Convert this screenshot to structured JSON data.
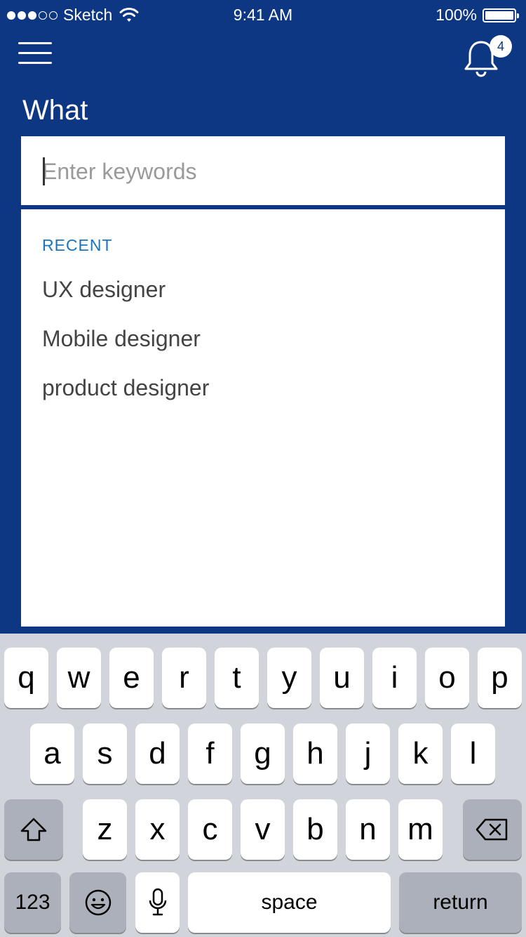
{
  "status_bar": {
    "carrier": "Sketch",
    "time": "9:41 AM",
    "battery": "100%"
  },
  "header": {
    "menu_icon": "hamburger-icon",
    "bell_icon": "bell-icon",
    "notification_count": "4"
  },
  "search": {
    "label": "What",
    "placeholder": "Enter keywords",
    "value": ""
  },
  "recent": {
    "header": "RECENT",
    "items": [
      "UX designer",
      "Mobile designer",
      "product designer"
    ]
  },
  "keyboard": {
    "row1": [
      "q",
      "w",
      "e",
      "r",
      "t",
      "y",
      "u",
      "i",
      "o",
      "p"
    ],
    "row2": [
      "a",
      "s",
      "d",
      "f",
      "g",
      "h",
      "j",
      "k",
      "l"
    ],
    "row3": [
      "z",
      "x",
      "c",
      "v",
      "b",
      "n",
      "m"
    ],
    "numbers_label": "123",
    "space_label": "space",
    "return_label": "return",
    "shift_icon": "shift-icon",
    "delete_icon": "backspace-icon",
    "emoji_icon": "emoji-icon",
    "mic_icon": "microphone-icon"
  },
  "colors": {
    "brand_blue": "#0d3782",
    "accent_blue": "#1b75bc"
  }
}
